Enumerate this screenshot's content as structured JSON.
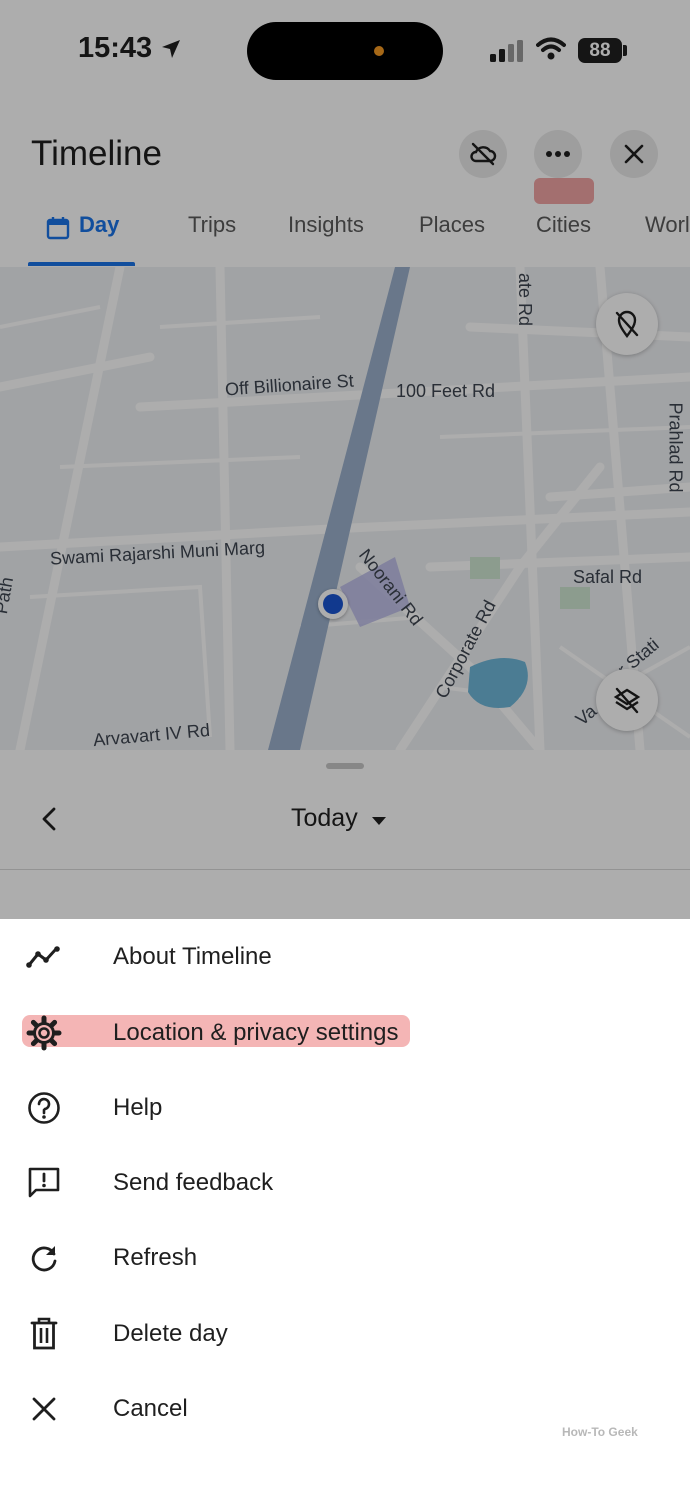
{
  "status_bar": {
    "time": "15:43",
    "battery": "88"
  },
  "header": {
    "title": "Timeline",
    "tabs": [
      {
        "label": "Day",
        "active": true
      },
      {
        "label": "Trips"
      },
      {
        "label": "Insights"
      },
      {
        "label": "Places"
      },
      {
        "label": "Cities"
      },
      {
        "label": "World"
      }
    ]
  },
  "map": {
    "labels": [
      "Off Billionaire St",
      "100 Feet Rd",
      "Swami Rajarshi Muni Marg",
      "Noorani Rd",
      "Corporate Rd",
      "Safal Rd",
      "Arvavart IV Rd",
      "Prahlad Rd",
      "ate Rd",
      "Path",
      "Va",
      "r Stati"
    ]
  },
  "day_nav": {
    "date_label": "Today"
  },
  "menu": {
    "items": [
      {
        "label": "About Timeline",
        "icon": "timeline-icon"
      },
      {
        "label": "Location & privacy settings",
        "icon": "gear-icon"
      },
      {
        "label": "Help",
        "icon": "help-icon"
      },
      {
        "label": "Send feedback",
        "icon": "feedback-icon"
      },
      {
        "label": "Refresh",
        "icon": "refresh-icon"
      },
      {
        "label": "Delete day",
        "icon": "trash-icon"
      },
      {
        "label": "Cancel",
        "icon": "close-icon"
      }
    ]
  },
  "watermark": "How-To Geek",
  "colors": {
    "accent": "#1a73e8",
    "highlight": "#f4b5b5",
    "location_dot": "#1a54d1"
  }
}
